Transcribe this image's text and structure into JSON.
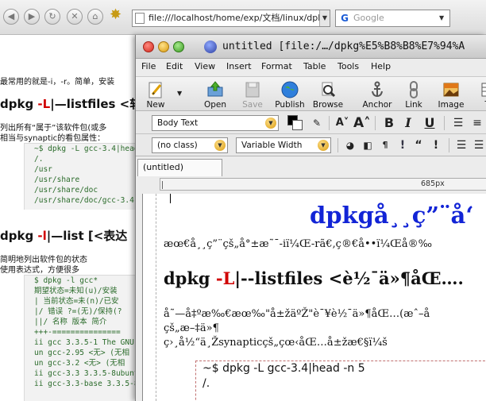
{
  "browser": {
    "url": "file:///localhost/home/exp/文档/linux/dpk",
    "search_placeholder": "Google",
    "content": {
      "intro_line": "最常用的就是-i，-r。简单，安装",
      "section1_heading": "dpkg -L|—listfiles <软",
      "section1_text1": "列出所有“属于”该软件包(或多",
      "section1_text2": "相当与synaptic的看包属性：",
      "code1": [
        "~$ dpkg -L gcc-3.4|head",
        "/.",
        "/usr",
        "/usr/share",
        "/usr/share/doc",
        "/usr/share/doc/gcc-3.4"
      ],
      "section2_heading": "dpkg -l|—list [<表达",
      "section2_text1": "简明地列出软件包的状态",
      "section2_text2": "使用表达式，方便很多",
      "code2": [
        "$ dpkg -l gcc*",
        "期望状态=未知(u)/安装",
        "| 当前状态=未(n)/已安",
        "|/ 错误 ?=(无)/保持(?",
        "||/ 名称 版本 简介",
        "+++-===============",
        "ii gcc 3.3.5-1 The GNU C",
        "un gcc-2.95 <无> (无相",
        "un gcc-3.2 <无> (无相",
        "ii gcc-3.3 3.3.5-8ubuntu",
        "ii gcc-3.3-base 3.3.5-8"
      ]
    }
  },
  "composer": {
    "window_title": "untitled [file:/…/dpkg%E5%B8%B8%E7%94%A",
    "menu": [
      "File",
      "Edit",
      "View",
      "Insert",
      "Format",
      "Table",
      "Tools",
      "Help"
    ],
    "toolbar": {
      "new": "New",
      "open": "Open",
      "save": "Save",
      "publish": "Publish",
      "browse": "Browse",
      "anchor": "Anchor",
      "link": "Link",
      "image": "Image",
      "table": "Ta"
    },
    "paragraph_style": "Body Text",
    "class_select": "(no class)",
    "font_select": "Variable Width",
    "tab_label": "(untitled)",
    "ruler_label": "685px",
    "editor": {
      "title": "dpkgå¸¸ç”¨å‘",
      "line1": "æœ€å¸¸ç”¨çš„å°±æ˜¯-iï¼Œ-rã€‚ç®€å••ï¼Œå®‰",
      "heading_prefix": "dpkg ",
      "heading_red": "-L",
      "heading_rest": "|--listfiles <è½¯ä»¶åŒ….",
      "line2": "å˜—å‡ºæ‰€æœ‰\"å±žäºŽ\"è¯¥è½¯ä»¶åŒ…(æˆ–å",
      "line3": "çš„æ–‡ä»¶",
      "line4": "ç›¸å½“ä¸Žsynapticçš„çœ‹åŒ…å±žæ€§ï¼š",
      "code": [
        "~$ dpkg -L gcc-3.4|head -n 5",
        "/."
      ]
    }
  }
}
